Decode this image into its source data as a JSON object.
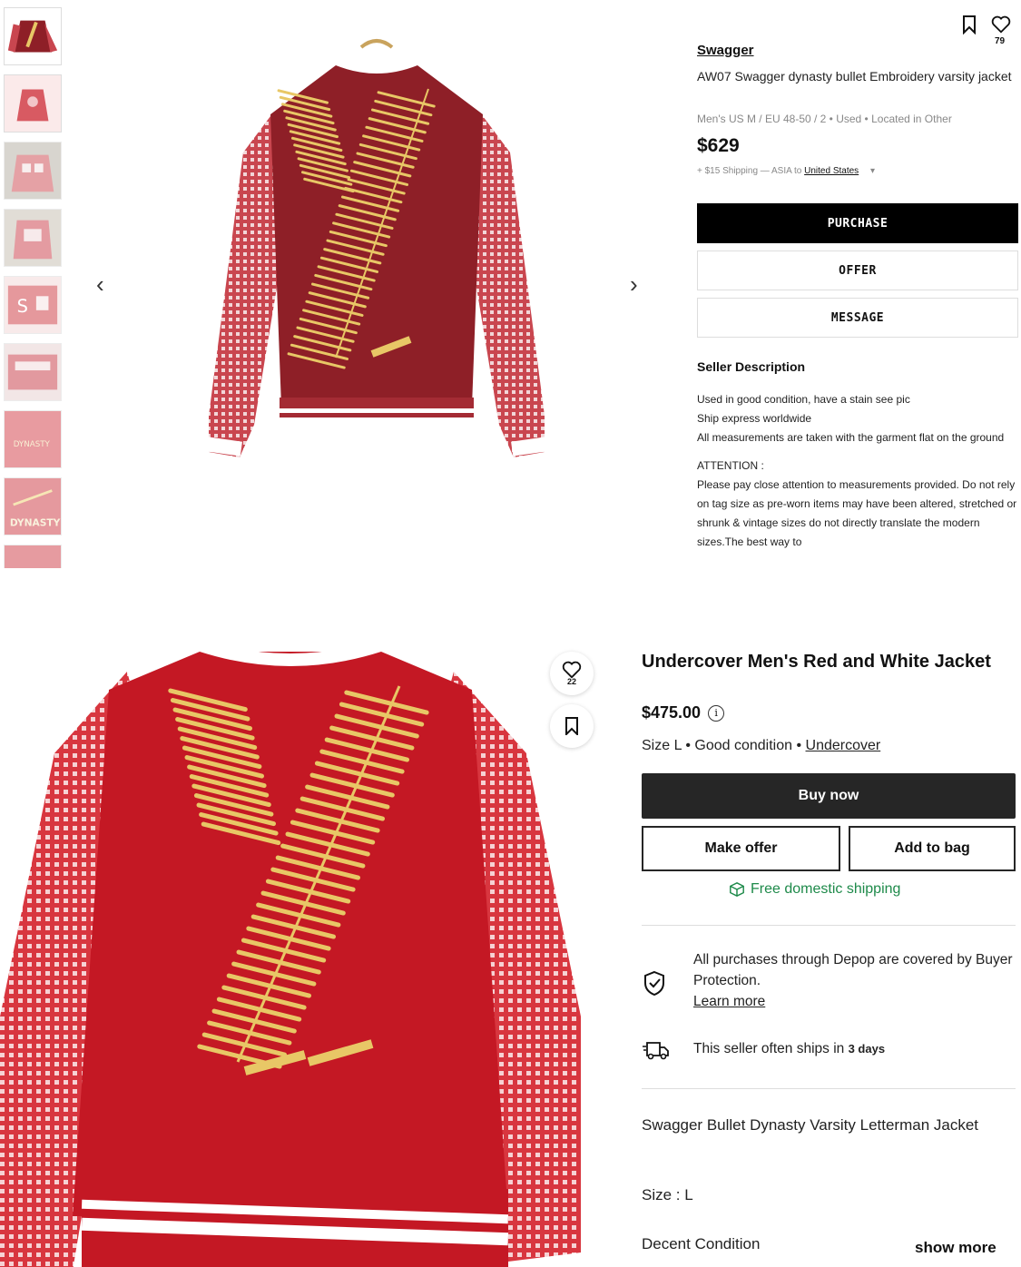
{
  "top_listing": {
    "seller": "Swagger",
    "title": "AW07 Swagger dynasty bullet Embroidery varsity jacket",
    "meta": "Men's US M / EU 48-50 / 2  •  Used  •  Located in Other",
    "price": "$629",
    "shipping_prefix": "+ $15 Shipping — ASIA to ",
    "shipping_country": "United States",
    "shipping_caret": "▾",
    "like_count": "79",
    "purchase_label": "PURCHASE",
    "offer_label": "OFFER",
    "message_label": "MESSAGE",
    "desc_heading": "Seller Description",
    "desc_lines": [
      "Used in good condition, have a stain see pic",
      "Ship express worldwide",
      "All measurements are taken with the garment flat on the ground",
      "ATTENTION :",
      "Please pay close attention to measurements provided. Do not rely on tag size as pre-worn items may have been altered, stretched or shrunk & vintage sizes do not directly translate the modern sizes.The best way to"
    ],
    "prev_arrow": "‹",
    "next_arrow": "›",
    "thumb_labels": [
      "DYNASTY",
      "DYNASTY"
    ]
  },
  "bottom_listing": {
    "title": "Undercover Men's Red and White Jacket",
    "price": "$475.00",
    "info_glyph": "i",
    "size": "Size L",
    "condition": "Good condition",
    "brand": "Undercover",
    "like_count": "22",
    "buy_now_label": "Buy now",
    "make_offer_label": "Make offer",
    "add_to_bag_label": "Add to bag",
    "free_shipping": "Free domestic shipping",
    "protection_text": "All purchases through Depop are covered by Buyer Protection.",
    "learn_more": "Learn more",
    "ships_text": "This seller often ships in ",
    "ships_days": "3 days",
    "description": "Swagger Bullet Dynasty Varsity Letterman Jacket",
    "size_line": "Size : L",
    "condition_line": "Decent Condition",
    "show_more": "show more"
  },
  "colors": {
    "top_body": "#8e1f27",
    "top_sleeve": "#c9464f",
    "bottom_body": "#c41824",
    "bottom_sleeve": "#d8363f",
    "embroidery": "#e8c766",
    "stripe": "#ffffff",
    "green": "#1e8a4a"
  },
  "icons": [
    "bookmark-icon",
    "heart-icon",
    "chevron-left-icon",
    "chevron-right-icon",
    "info-icon",
    "box-icon",
    "shield-check-icon",
    "delivery-truck-icon"
  ]
}
